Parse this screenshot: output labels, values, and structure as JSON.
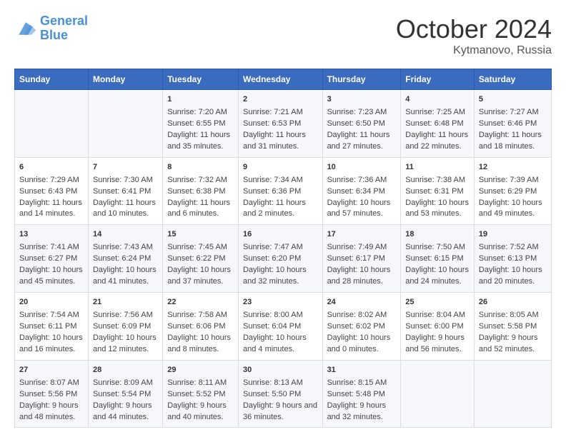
{
  "header": {
    "logo_line1": "General",
    "logo_line2": "Blue",
    "month": "October 2024",
    "location": "Kytmanovo, Russia"
  },
  "days_of_week": [
    "Sunday",
    "Monday",
    "Tuesday",
    "Wednesday",
    "Thursday",
    "Friday",
    "Saturday"
  ],
  "weeks": [
    [
      {
        "day": "",
        "info": ""
      },
      {
        "day": "",
        "info": ""
      },
      {
        "day": "1",
        "info": "Sunrise: 7:20 AM\nSunset: 6:55 PM\nDaylight: 11 hours and 35 minutes."
      },
      {
        "day": "2",
        "info": "Sunrise: 7:21 AM\nSunset: 6:53 PM\nDaylight: 11 hours and 31 minutes."
      },
      {
        "day": "3",
        "info": "Sunrise: 7:23 AM\nSunset: 6:50 PM\nDaylight: 11 hours and 27 minutes."
      },
      {
        "day": "4",
        "info": "Sunrise: 7:25 AM\nSunset: 6:48 PM\nDaylight: 11 hours and 22 minutes."
      },
      {
        "day": "5",
        "info": "Sunrise: 7:27 AM\nSunset: 6:46 PM\nDaylight: 11 hours and 18 minutes."
      }
    ],
    [
      {
        "day": "6",
        "info": "Sunrise: 7:29 AM\nSunset: 6:43 PM\nDaylight: 11 hours and 14 minutes."
      },
      {
        "day": "7",
        "info": "Sunrise: 7:30 AM\nSunset: 6:41 PM\nDaylight: 11 hours and 10 minutes."
      },
      {
        "day": "8",
        "info": "Sunrise: 7:32 AM\nSunset: 6:38 PM\nDaylight: 11 hours and 6 minutes."
      },
      {
        "day": "9",
        "info": "Sunrise: 7:34 AM\nSunset: 6:36 PM\nDaylight: 11 hours and 2 minutes."
      },
      {
        "day": "10",
        "info": "Sunrise: 7:36 AM\nSunset: 6:34 PM\nDaylight: 10 hours and 57 minutes."
      },
      {
        "day": "11",
        "info": "Sunrise: 7:38 AM\nSunset: 6:31 PM\nDaylight: 10 hours and 53 minutes."
      },
      {
        "day": "12",
        "info": "Sunrise: 7:39 AM\nSunset: 6:29 PM\nDaylight: 10 hours and 49 minutes."
      }
    ],
    [
      {
        "day": "13",
        "info": "Sunrise: 7:41 AM\nSunset: 6:27 PM\nDaylight: 10 hours and 45 minutes."
      },
      {
        "day": "14",
        "info": "Sunrise: 7:43 AM\nSunset: 6:24 PM\nDaylight: 10 hours and 41 minutes."
      },
      {
        "day": "15",
        "info": "Sunrise: 7:45 AM\nSunset: 6:22 PM\nDaylight: 10 hours and 37 minutes."
      },
      {
        "day": "16",
        "info": "Sunrise: 7:47 AM\nSunset: 6:20 PM\nDaylight: 10 hours and 32 minutes."
      },
      {
        "day": "17",
        "info": "Sunrise: 7:49 AM\nSunset: 6:17 PM\nDaylight: 10 hours and 28 minutes."
      },
      {
        "day": "18",
        "info": "Sunrise: 7:50 AM\nSunset: 6:15 PM\nDaylight: 10 hours and 24 minutes."
      },
      {
        "day": "19",
        "info": "Sunrise: 7:52 AM\nSunset: 6:13 PM\nDaylight: 10 hours and 20 minutes."
      }
    ],
    [
      {
        "day": "20",
        "info": "Sunrise: 7:54 AM\nSunset: 6:11 PM\nDaylight: 10 hours and 16 minutes."
      },
      {
        "day": "21",
        "info": "Sunrise: 7:56 AM\nSunset: 6:09 PM\nDaylight: 10 hours and 12 minutes."
      },
      {
        "day": "22",
        "info": "Sunrise: 7:58 AM\nSunset: 6:06 PM\nDaylight: 10 hours and 8 minutes."
      },
      {
        "day": "23",
        "info": "Sunrise: 8:00 AM\nSunset: 6:04 PM\nDaylight: 10 hours and 4 minutes."
      },
      {
        "day": "24",
        "info": "Sunrise: 8:02 AM\nSunset: 6:02 PM\nDaylight: 10 hours and 0 minutes."
      },
      {
        "day": "25",
        "info": "Sunrise: 8:04 AM\nSunset: 6:00 PM\nDaylight: 9 hours and 56 minutes."
      },
      {
        "day": "26",
        "info": "Sunrise: 8:05 AM\nSunset: 5:58 PM\nDaylight: 9 hours and 52 minutes."
      }
    ],
    [
      {
        "day": "27",
        "info": "Sunrise: 8:07 AM\nSunset: 5:56 PM\nDaylight: 9 hours and 48 minutes."
      },
      {
        "day": "28",
        "info": "Sunrise: 8:09 AM\nSunset: 5:54 PM\nDaylight: 9 hours and 44 minutes."
      },
      {
        "day": "29",
        "info": "Sunrise: 8:11 AM\nSunset: 5:52 PM\nDaylight: 9 hours and 40 minutes."
      },
      {
        "day": "30",
        "info": "Sunrise: 8:13 AM\nSunset: 5:50 PM\nDaylight: 9 hours and 36 minutes."
      },
      {
        "day": "31",
        "info": "Sunrise: 8:15 AM\nSunset: 5:48 PM\nDaylight: 9 hours and 32 minutes."
      },
      {
        "day": "",
        "info": ""
      },
      {
        "day": "",
        "info": ""
      }
    ]
  ]
}
